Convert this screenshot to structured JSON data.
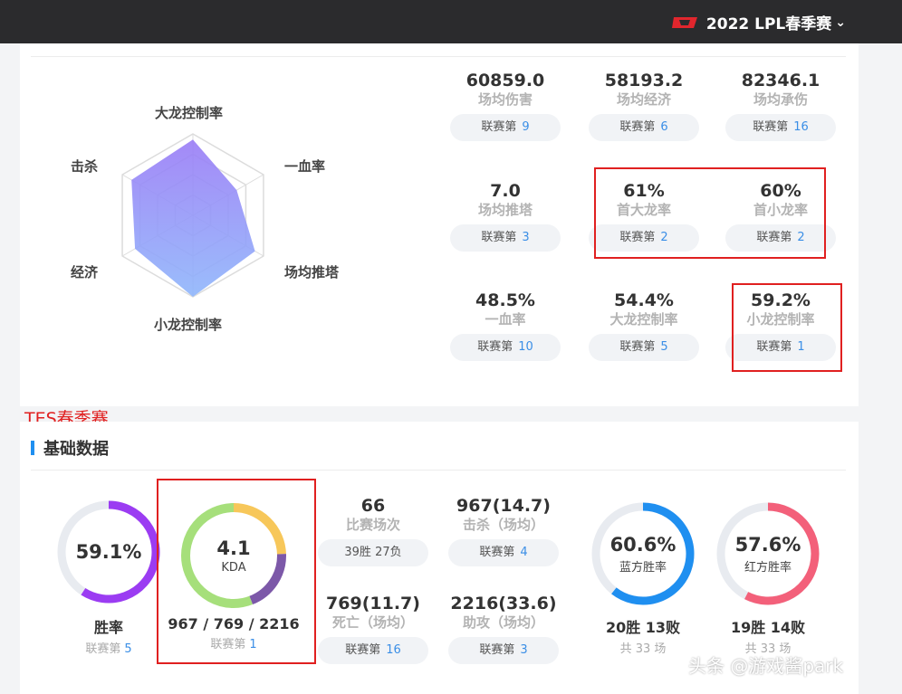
{
  "header": {
    "season_label": "2022 LPL春季赛",
    "dropdown_icon": "chevron-down-icon"
  },
  "radar": {
    "labels": [
      "大龙控制率",
      "一血率",
      "场均推塔",
      "小龙控制率",
      "经济",
      "击杀"
    ],
    "values": [
      0.93,
      0.62,
      0.88,
      1.0,
      0.82,
      0.87
    ],
    "fill_color": "#8e8cf7"
  },
  "team_stats": [
    {
      "value": "60859.0",
      "label": "场均伤害",
      "rank_prefix": "联赛第",
      "rank": "9"
    },
    {
      "value": "58193.2",
      "label": "场均经济",
      "rank_prefix": "联赛第",
      "rank": "6"
    },
    {
      "value": "82346.1",
      "label": "场均承伤",
      "rank_prefix": "联赛第",
      "rank": "16"
    },
    {
      "value": "7.0",
      "label": "场均推塔",
      "rank_prefix": "联赛第",
      "rank": "3"
    },
    {
      "value": "61%",
      "label": "首大龙率",
      "rank_prefix": "联赛第",
      "rank": "2"
    },
    {
      "value": "60%",
      "label": "首小龙率",
      "rank_prefix": "联赛第",
      "rank": "2"
    },
    {
      "value": "48.5%",
      "label": "一血率",
      "rank_prefix": "联赛第",
      "rank": "10"
    },
    {
      "value": "54.4%",
      "label": "大龙控制率",
      "rank_prefix": "联赛第",
      "rank": "5"
    },
    {
      "value": "59.2%",
      "label": "小龙控制率",
      "rank_prefix": "联赛第",
      "rank": "1"
    }
  ],
  "annotation": "TES春季赛",
  "basic": {
    "title": "基础数据",
    "winrate": {
      "value": "59.1%",
      "fraction": 0.591,
      "label": "胜率",
      "rank_prefix": "联赛第",
      "rank": "5",
      "color": "#9b3cf2"
    },
    "kda": {
      "value": "4.1",
      "unit": "KDA",
      "kda_line": "967 / 769 / 2216",
      "rank_prefix": "联赛第",
      "rank": "1",
      "segments": [
        {
          "fraction": 0.245,
          "color": "#f7c75a"
        },
        {
          "fraction": 0.196,
          "color": "#7c58a8"
        },
        {
          "fraction": 0.559,
          "color": "#a6df7b"
        }
      ]
    },
    "matches": {
      "value": "66",
      "label": "比赛场次",
      "sub": "39胜 27负"
    },
    "kills": {
      "value": "967(14.7)",
      "label": "击杀（场均）",
      "rank_prefix": "联赛第",
      "rank": "4"
    },
    "deaths": {
      "value": "769(11.7)",
      "label": "死亡（场均）",
      "rank_prefix": "联赛第",
      "rank": "16"
    },
    "assists": {
      "value": "2216(33.6)",
      "label": "助攻（场均）",
      "rank_prefix": "联赛第",
      "rank": "3"
    },
    "blue": {
      "value": "60.6%",
      "fraction": 0.606,
      "inner_label": "蓝方胜率",
      "record": "20胜 13败",
      "total": "共 33 场",
      "color": "#1f8ff0"
    },
    "red": {
      "value": "57.6%",
      "fraction": 0.576,
      "inner_label": "红方胜率",
      "record": "19胜 14败",
      "total": "共 33 场",
      "color": "#f3607a"
    }
  },
  "watermark": "头条 @游戏酱park"
}
